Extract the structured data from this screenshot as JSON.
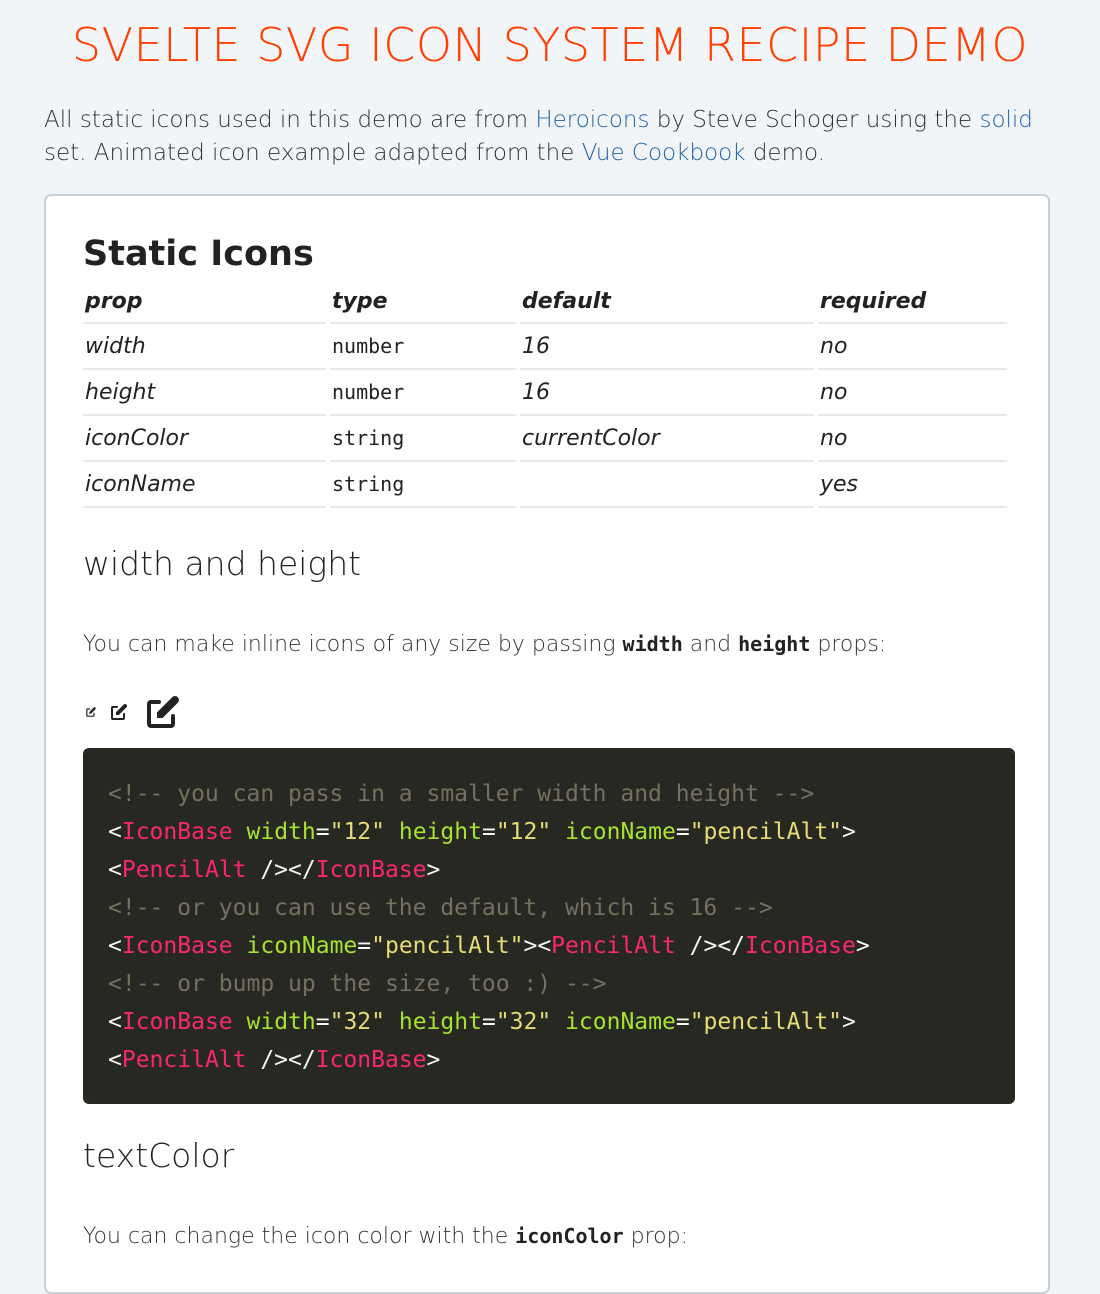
{
  "page_title": "SVELTE SVG ICON SYSTEM RECIPE DEMO",
  "intro": {
    "t1": "All static icons used in this demo are from ",
    "link_heroicons": "Heroicons",
    "t2": " by Steve Schoger using the ",
    "link_solid": "solid",
    "t3": " set. Animated icon example adapted from the ",
    "link_vue": "Vue Cookbook",
    "t4": " demo."
  },
  "static_section": {
    "heading": "Static Icons",
    "table": {
      "headers": [
        "prop",
        "type",
        "default",
        "required"
      ],
      "rows": [
        [
          "width",
          "number",
          "16",
          "no"
        ],
        [
          "height",
          "number",
          "16",
          "no"
        ],
        [
          "iconColor",
          "string",
          "currentColor",
          "no"
        ],
        [
          "iconName",
          "string",
          "",
          "yes"
        ]
      ]
    }
  },
  "width_height": {
    "heading": "width and height",
    "desc_pre": "You can make inline icons of any size by passing ",
    "code1": "width",
    "desc_mid": " and ",
    "code2": "height",
    "desc_post": " props:",
    "icons": [
      "pencil-alt-icon",
      "pencil-alt-icon",
      "pencil-alt-icon"
    ],
    "code_lines": {
      "c1": "<!-- you can pass in a smaller width and height -->",
      "c2": "<!-- or you can use the default, which is 16 -->",
      "c3": "<!-- or bump up the size, too :) -->",
      "tag_iconbase": "IconBase",
      "tag_pencil": "PencilAlt",
      "attr_width": "width",
      "attr_height": "height",
      "attr_iconname": "iconName",
      "val_12": "\"12\"",
      "val_32": "\"32\"",
      "val_pencil": "\"pencilAlt\""
    }
  },
  "text_color": {
    "heading": "textColor",
    "desc_pre": "You can change the icon color with the ",
    "code": "iconColor",
    "desc_post": " prop:"
  }
}
